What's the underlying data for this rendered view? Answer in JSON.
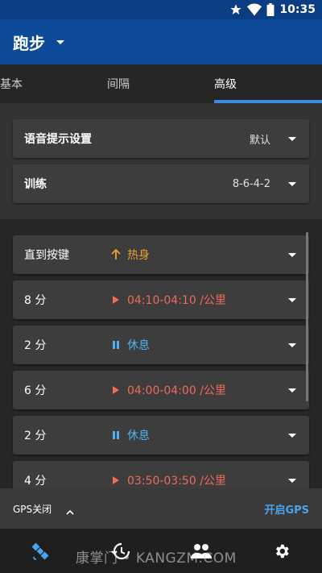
{
  "status_bar": {
    "time": "10:35"
  },
  "app_bar": {
    "title": "跑步"
  },
  "tabs": [
    {
      "label": "基本"
    },
    {
      "label": "间隔"
    },
    {
      "label": "高级",
      "active": true
    }
  ],
  "settings": {
    "voice": {
      "label": "语音提示设置",
      "value": "默认"
    },
    "training": {
      "label": "训练",
      "value": "8-6-4-2"
    }
  },
  "steps": [
    {
      "duration": "直到按键",
      "icon": "arrow-up-icon",
      "text": "热身",
      "color": "#f0a030"
    },
    {
      "duration": "8 分",
      "icon": "play-icon",
      "text": "04:10-04:10 /公里",
      "color": "#f06a5a"
    },
    {
      "duration": "2 分",
      "icon": "pause-icon",
      "text": "休息",
      "color": "#4ab4f0"
    },
    {
      "duration": "6 分",
      "icon": "play-icon",
      "text": "04:00-04:00 /公里",
      "color": "#f06a5a"
    },
    {
      "duration": "2 分",
      "icon": "pause-icon",
      "text": "休息",
      "color": "#4ab4f0"
    },
    {
      "duration": "4 分",
      "icon": "play-icon",
      "text": "03:50-03:50 /公里",
      "color": "#f06a5a"
    }
  ],
  "gps_bar": {
    "status": "GPS关闭",
    "action": "开启GPS"
  },
  "bottom_nav": [
    {
      "icon": "satellite-icon"
    },
    {
      "icon": "history-icon"
    },
    {
      "icon": "people-icon"
    },
    {
      "icon": "settings-icon"
    }
  ],
  "watermark": "康掌门 • KANGZM.COM",
  "colors": {
    "primary": "#0d4a98",
    "accent": "#3a8de0",
    "warmup": "#f0a030",
    "run": "#f06a5a",
    "rest": "#4ab4f0"
  }
}
